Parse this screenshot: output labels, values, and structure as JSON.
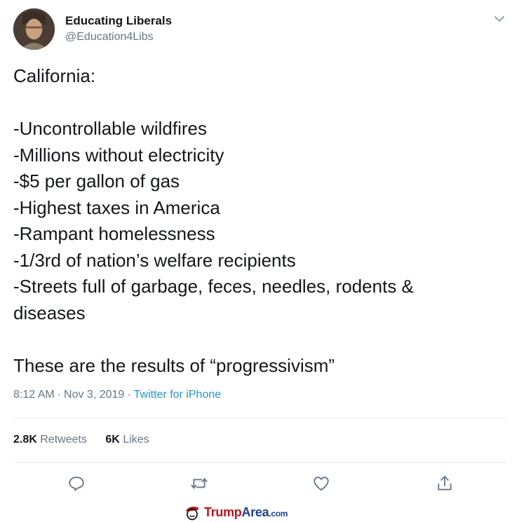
{
  "author": {
    "display_name": "Educating Liberals",
    "handle": "@Education4Libs"
  },
  "tweet": {
    "lines": [
      "California:",
      "",
      "-Uncontrollable wildfires",
      "-Millions without electricity",
      "-$5 per gallon of gas",
      "-Highest taxes in America",
      "-Rampant homelessness",
      "-1/3rd of nation’s welfare recipients",
      "-Streets full of garbage, feces, needles, rodents &",
      "diseases",
      "",
      "These are the results of “progressivism”"
    ],
    "time": "8:12 AM",
    "date": "Nov 3, 2019",
    "separator": "·",
    "source": "Twitter for iPhone"
  },
  "stats": {
    "retweets_count": "2.8K",
    "retweets_label": "Retweets",
    "likes_count": "6K",
    "likes_label": "Likes"
  },
  "actions": {
    "reply_icon": "reply-icon",
    "retweet_icon": "retweet-icon",
    "like_icon": "heart-icon",
    "share_icon": "share-icon"
  },
  "watermark": {
    "part1": "Trump",
    "part2": "Area",
    "part3": ".com"
  },
  "colors": {
    "text": "#14171a",
    "secondary": "#657786",
    "link": "#1b95e0",
    "divider": "#e6ecf0",
    "icon": "#657786"
  }
}
